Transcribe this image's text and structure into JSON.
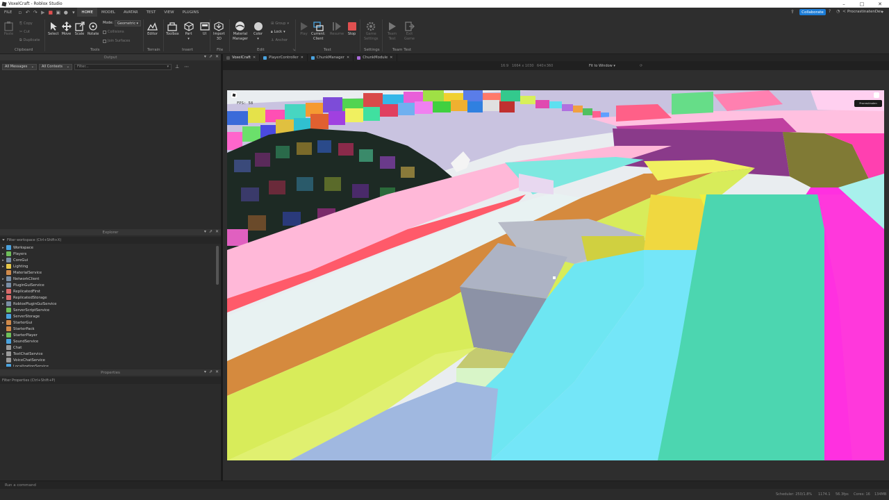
{
  "window": {
    "title": "VoxelCraft - Roblox Studio"
  },
  "menu": {
    "file": "FILE",
    "tabs": [
      "HOME",
      "MODEL",
      "AVATAR",
      "TEST",
      "VIEW",
      "PLUGINS"
    ],
    "active": "HOME"
  },
  "account": {
    "collaborate": "Collaborate",
    "user": "ProcrastinatenDev"
  },
  "ribbon": {
    "clipboard": {
      "paste": "Paste",
      "copy": "Copy",
      "cut": "Cut",
      "duplicate": "Duplicate",
      "group": "Clipboard"
    },
    "tools": {
      "select": "Select",
      "move": "Move",
      "scale": "Scale",
      "rotate": "Rotate",
      "group": "Tools",
      "mode_label": "Mode:",
      "mode_value": "Geometric",
      "collisions": "Collisions",
      "join_surfaces": "Join Surfaces"
    },
    "terrain": {
      "editor": "Editor",
      "group": "Terrain"
    },
    "insert": {
      "toolbox": "Toolbox",
      "part": "Part",
      "ui": "UI",
      "group": "Insert"
    },
    "file": {
      "import3d_1": "Import",
      "import3d_2": "3D",
      "group": "File"
    },
    "edit": {
      "material_1": "Material",
      "material_2": "Manager",
      "color": "Color",
      "group_btn": "Group",
      "lock": "Lock",
      "anchor": "Anchor",
      "group": "Edit"
    },
    "test": {
      "play": "Play",
      "current_1": "Current:",
      "current_2": "Client",
      "resume": "Resume",
      "stop": "Stop",
      "group": "Test"
    },
    "settings": {
      "game_1": "Game",
      "game_2": "Settings",
      "group": "Settings"
    },
    "team": {
      "team_1": "Team",
      "team_2": "Test",
      "exit_1": "Exit",
      "exit_2": "Game",
      "group": "Team Test"
    }
  },
  "output": {
    "title": "Output",
    "all_messages": "All Messages",
    "all_contexts": "All Contexts",
    "filter_placeholder": "Filter..."
  },
  "explorer": {
    "title": "Explorer",
    "filter": "Filter workspace (Ctrl+Shift+X)",
    "items": [
      {
        "label": "Workspace",
        "arrow": "▸",
        "color": "#4aa3df"
      },
      {
        "label": "Players",
        "arrow": "▸",
        "color": "#6fbf5a"
      },
      {
        "label": "CoreGui",
        "arrow": "▸",
        "color": "#7a8fa6"
      },
      {
        "label": "Lighting",
        "arrow": "▸",
        "color": "#e6c84a"
      },
      {
        "label": "MaterialService",
        "arrow": "",
        "color": "#d08a4a"
      },
      {
        "label": "NetworkClient",
        "arrow": "▸",
        "color": "#7a8fa6"
      },
      {
        "label": "PluginGuiService",
        "arrow": "▸",
        "color": "#7a8fa6"
      },
      {
        "label": "ReplicatedFirst",
        "arrow": "▸",
        "color": "#d96a6a"
      },
      {
        "label": "ReplicatedStorage",
        "arrow": "▸",
        "color": "#d96a6a"
      },
      {
        "label": "RobloxPluginGuiService",
        "arrow": "▸",
        "color": "#7a8fa6"
      },
      {
        "label": "ServerScriptService",
        "arrow": "",
        "color": "#6fbf5a"
      },
      {
        "label": "ServerStorage",
        "arrow": "",
        "color": "#4aa3df"
      },
      {
        "label": "StarterGui",
        "arrow": "▸",
        "color": "#d08a4a"
      },
      {
        "label": "StarterPack",
        "arrow": "",
        "color": "#d08a4a"
      },
      {
        "label": "StarterPlayer",
        "arrow": "▸",
        "color": "#6fbf5a"
      },
      {
        "label": "SoundService",
        "arrow": "",
        "color": "#4aa3df"
      },
      {
        "label": "Chat",
        "arrow": "",
        "color": "#9a9a9a"
      },
      {
        "label": "TextChatService",
        "arrow": "▸",
        "color": "#9a9a9a"
      },
      {
        "label": "VoiceChatService",
        "arrow": "",
        "color": "#9a9a9a"
      },
      {
        "label": "LocalizationService",
        "arrow": "",
        "color": "#4aa3df"
      }
    ]
  },
  "properties": {
    "title": "Properties",
    "filter": "Filter Properties (Ctrl+Shift+P)"
  },
  "doctabs": [
    {
      "label": "VoxelCraft",
      "color": "#555",
      "active": true
    },
    {
      "label": "PlayerController",
      "color": "#4aa3df",
      "active": false
    },
    {
      "label": "ChunkManager",
      "color": "#4aa3df",
      "active": false
    },
    {
      "label": "ChunkModule",
      "color": "#a86ad9",
      "active": false
    }
  ],
  "viewbar": {
    "d1": "16:9",
    "d2": "1664 x 1030",
    "d3": "640×360",
    "fit": "Fit to Window"
  },
  "game": {
    "fps": "FPS: 58",
    "button": "Procrastinaten"
  },
  "command": {
    "placeholder": "Run a command"
  },
  "status": {
    "scheduler": "Scheduler: 250/1.8%",
    "s2": "1174.1",
    "s3": "56.3fps",
    "s4": "Cores: 16",
    "s5": "134MB"
  }
}
